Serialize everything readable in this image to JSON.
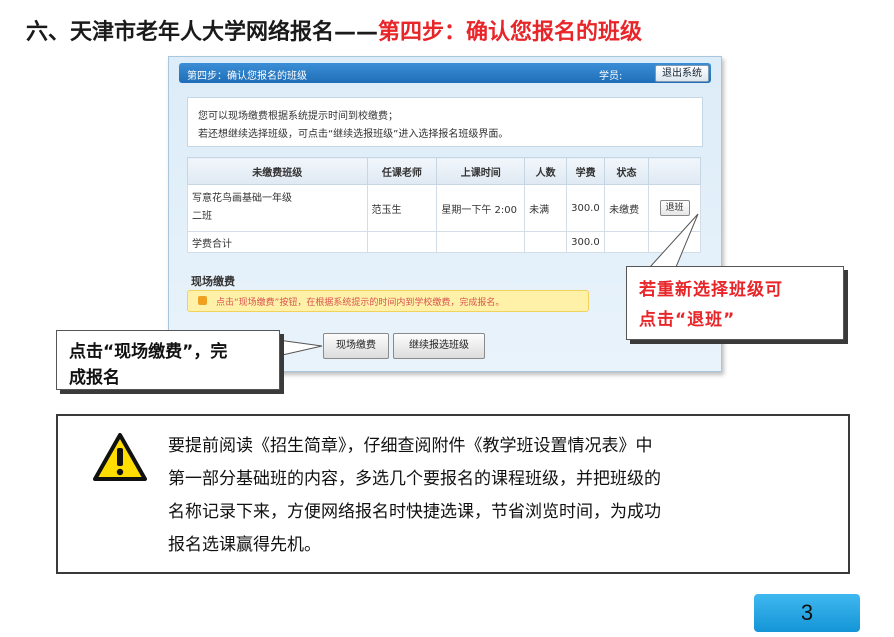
{
  "heading": {
    "prefix": "六、天津市老年人大学网络报名——",
    "highlight": "第四步：确认您报名的班级"
  },
  "panel": {
    "step_title": "第四步：确认您报名的班级",
    "student_label": "学员:",
    "logout_label": "退出系统",
    "notice_line1": "您可以现场缴费根据系统提示时间到校缴费；",
    "notice_line2": "若还想继续选择班级，可点击“继续选报班级”进入选择报名班级界面。",
    "table": {
      "headers": [
        "未缴费班级",
        "任课老师",
        "上课时间",
        "人数",
        "学费",
        "状态",
        ""
      ],
      "row": {
        "name_line1": "写意花鸟画基础一年级",
        "name_line2": "二班",
        "teacher": "范玉生",
        "time": "星期一下午 2:00",
        "count": "未满",
        "fee": "300.0",
        "status": "未缴费",
        "action": "退班"
      },
      "total_label": "学费合计",
      "total_fee": "300.0"
    },
    "onsite_title": "现场缴费",
    "onsite_tip": "点击“现场缴费”按钮，在根据系统提示的时间内到学校缴费，完成报名。",
    "pay_button": "现场缴费",
    "continue_button": "继续报选班级"
  },
  "callouts": {
    "right_line1": "若重新选择班级可",
    "right_line2": "点击“退班”",
    "left_line1": "点击“现场缴费”，完",
    "left_line2": "成报名"
  },
  "tip": {
    "lines": [
      "要提前阅读《招生简章》，仔细查阅附件《教学班设置情况表》中",
      "第一部分基础班的内容，多选几个要报名的课程班级，并把班级的",
      "名称记录下来，方便网络报名时快捷选课，节省浏览时间，为成功",
      "报名选课赢得先机。"
    ]
  },
  "page_number": "3",
  "colors": {
    "accent_red": "#e8262a",
    "header_blue": "#1f6db8",
    "page_badge": "#1495d6"
  }
}
